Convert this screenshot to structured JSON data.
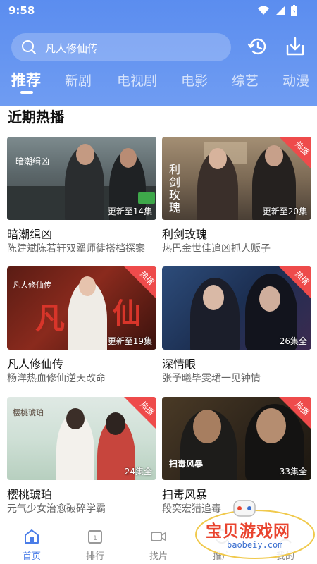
{
  "status": {
    "time": "9:58"
  },
  "search": {
    "query": "凡人修仙传"
  },
  "tabs": [
    {
      "label": "推荐"
    },
    {
      "label": "新剧"
    },
    {
      "label": "电视剧"
    },
    {
      "label": "电影"
    },
    {
      "label": "综艺"
    },
    {
      "label": "动漫"
    }
  ],
  "section": {
    "title": "近期热播"
  },
  "cards": [
    {
      "title": "暗潮缉凶",
      "desc": "陈建斌陈若轩双犟师徒搭档探案",
      "badge": "更新至14集",
      "hot": "",
      "poster_text": "暗潮缉凶"
    },
    {
      "title": "利剑玫瑰",
      "desc": "热巴金世佳追凶抓人贩子",
      "badge": "更新至20集",
      "hot": "热播",
      "poster_text": "利剑玫瑰"
    },
    {
      "title": "凡人修仙传",
      "desc": "杨洋热血修仙逆天改命",
      "badge": "更新至19集",
      "hot": "热播",
      "poster_text": "凡人修仙传"
    },
    {
      "title": "深情眼",
      "desc": "张予曦毕雯珺一见钟情",
      "badge": "26集全",
      "hot": "热播",
      "poster_text": ""
    },
    {
      "title": "樱桃琥珀",
      "desc": "元气少女治愈破碎学霸",
      "badge": "24集全",
      "hot": "热播",
      "poster_text": "樱桃琥珀"
    },
    {
      "title": "扫毒风暴",
      "desc": "段奕宏猎追毒",
      "badge": "33集全",
      "hot": "热播",
      "poster_text": "扫毒风暴"
    }
  ],
  "nav": [
    {
      "label": "首页",
      "icon": "home-icon"
    },
    {
      "label": "排行",
      "icon": "ranking-icon"
    },
    {
      "label": "找片",
      "icon": "video-icon"
    },
    {
      "label": "推广",
      "icon": "share-icon"
    },
    {
      "label": "我的",
      "icon": "user-icon"
    }
  ],
  "watermark": {
    "text": "宝贝游戏网",
    "url": "baobeiy.com"
  },
  "colors": {
    "header": "#5b8def",
    "accent": "#4a7de8",
    "hot": "#ee4b4b"
  }
}
